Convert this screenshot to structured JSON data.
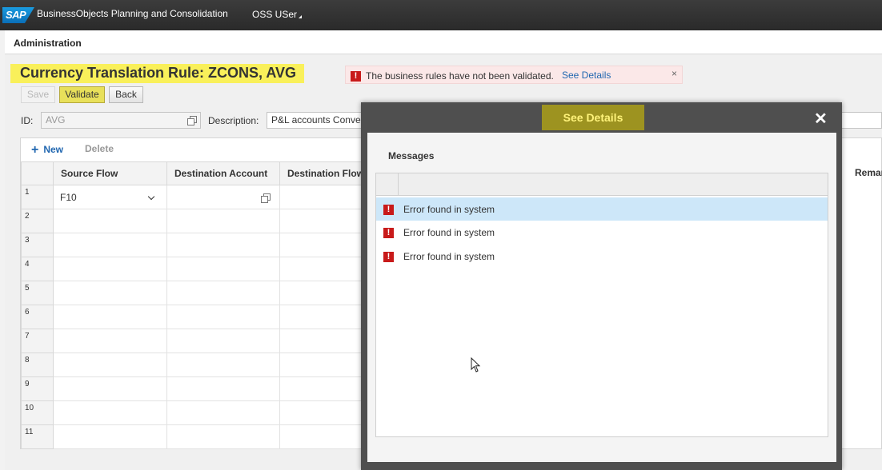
{
  "shell": {
    "logo": "SAP",
    "app_title": "BusinessObjects Planning and Consolidation",
    "user": "OSS USer"
  },
  "admin_bar": {
    "label": "Administration"
  },
  "page": {
    "title": "Currency Translation Rule: ZCONS, AVG",
    "buttons": {
      "save": "Save",
      "validate": "Validate",
      "back": "Back"
    },
    "id_label": "ID:",
    "id_value": "AVG",
    "description_label": "Description:",
    "description_value": "P&L accounts Conversion with Average Fx rate"
  },
  "banner": {
    "message": "The business rules have not been validated.",
    "link": "See Details",
    "close": "×"
  },
  "grid": {
    "toolbar": {
      "new": "New",
      "delete": "Delete"
    },
    "columns": [
      "Source Flow",
      "Destination Account",
      "Destination Flow"
    ],
    "extra_column": "Remar",
    "rows": [
      {
        "num": "1",
        "source_flow": "F10"
      },
      {
        "num": "2"
      },
      {
        "num": "3"
      },
      {
        "num": "4"
      },
      {
        "num": "5"
      },
      {
        "num": "6"
      },
      {
        "num": "7"
      },
      {
        "num": "8"
      },
      {
        "num": "9"
      },
      {
        "num": "10"
      },
      {
        "num": "11"
      }
    ]
  },
  "dialog": {
    "title": "See Details",
    "close": "✕",
    "heading": "Messages",
    "messages": [
      {
        "text": "Error found in system",
        "selected": true
      },
      {
        "text": "Error found in system",
        "selected": false
      },
      {
        "text": "Error found in system",
        "selected": false
      }
    ]
  },
  "colors": {
    "highlight": "#f9f05a",
    "error": "#c81a1a",
    "link": "#2167b0",
    "selection": "#cde7f9"
  }
}
